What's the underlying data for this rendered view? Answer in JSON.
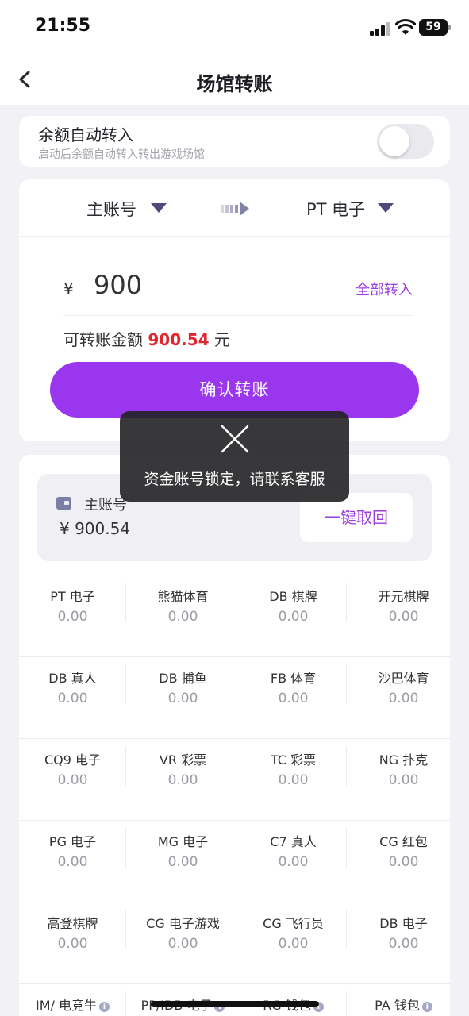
{
  "status_bar": {
    "time": "21:55",
    "battery": "59"
  },
  "header": {
    "title": "场馆转账"
  },
  "auto_transfer": {
    "title": "余额自动转入",
    "subtitle": "启动后余额自动转入转出游戏场馆",
    "enabled": false
  },
  "transfer": {
    "from_account": "主账号",
    "to_account": "PT 电子",
    "currency_symbol": "¥",
    "amount": "900",
    "all_in_label": "全部转入",
    "available_label": "可转账金额",
    "available_amount": "900.54",
    "available_unit": "元",
    "confirm_label": "确认转账"
  },
  "toast": {
    "message": "资金账号锁定，请联系客服"
  },
  "wallet": {
    "name": "主账号",
    "balance": "¥ 900.54",
    "reclaim_label": "一键取回"
  },
  "venues": [
    [
      {
        "name": "PT 电子",
        "value": "0.00"
      },
      {
        "name": "熊猫体育",
        "value": "0.00"
      },
      {
        "name": "DB 棋牌",
        "value": "0.00"
      },
      {
        "name": "开元棋牌",
        "value": "0.00"
      }
    ],
    [
      {
        "name": "DB 真人",
        "value": "0.00"
      },
      {
        "name": "DB 捕鱼",
        "value": "0.00"
      },
      {
        "name": "FB 体育",
        "value": "0.00"
      },
      {
        "name": "沙巴体育",
        "value": "0.00"
      }
    ],
    [
      {
        "name": "CQ9 电子",
        "value": "0.00"
      },
      {
        "name": "VR 彩票",
        "value": "0.00"
      },
      {
        "name": "TC 彩票",
        "value": "0.00"
      },
      {
        "name": "NG 扑克",
        "value": "0.00"
      }
    ],
    [
      {
        "name": "PG 电子",
        "value": "0.00"
      },
      {
        "name": "MG 电子",
        "value": "0.00"
      },
      {
        "name": "C7 真人",
        "value": "0.00"
      },
      {
        "name": "CG 红包",
        "value": "0.00"
      }
    ],
    [
      {
        "name": "高登棋牌",
        "value": "0.00"
      },
      {
        "name": "CG 电子游戏",
        "value": "0.00"
      },
      {
        "name": "CG 飞行员",
        "value": "0.00"
      },
      {
        "name": "DB 电子",
        "value": "0.00"
      }
    ],
    [
      {
        "name": "IM/ 电竞牛",
        "value": ""
      },
      {
        "name": "PP/IDB 电子",
        "value": ""
      },
      {
        "name": "RG 钱包",
        "value": ""
      },
      {
        "name": "PA 钱包",
        "value": ""
      }
    ]
  ],
  "colors": {
    "accent": "#9a37ee",
    "highlight_red": "#e0262c",
    "page_bg": "#f2f2f6"
  },
  "icons": {
    "back": "chevron-left-icon",
    "dropdown": "triangle-down-icon",
    "transfer": "arrow-right-icon",
    "toast": "close-icon",
    "wallet": "wallet-icon",
    "info": "info-icon"
  }
}
